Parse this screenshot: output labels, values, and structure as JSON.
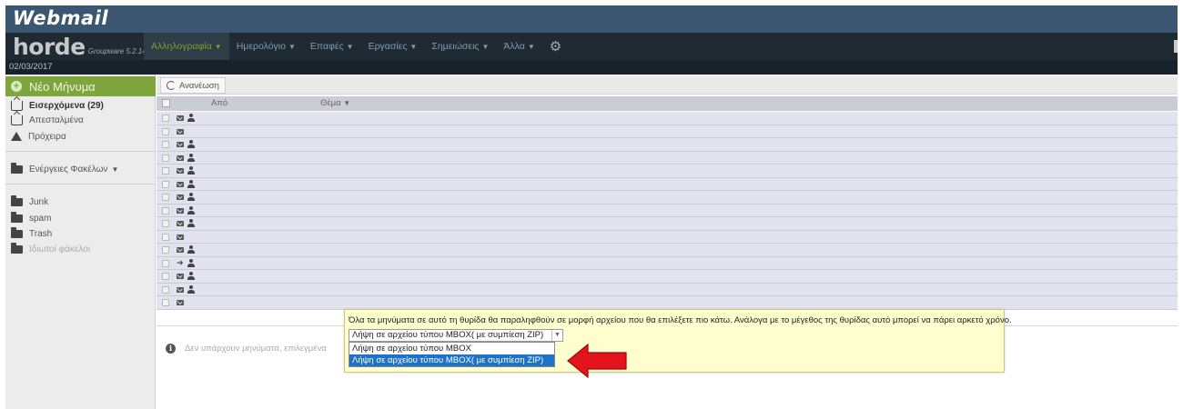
{
  "banner": {
    "brand": "Webmail"
  },
  "navbar": {
    "logo_word": "horde",
    "logo_sub": "Groupware 5.2.14",
    "menu": [
      {
        "label": "Αλληλογραφία",
        "active": true
      },
      {
        "label": "Ημερολόγιο",
        "active": false
      },
      {
        "label": "Επαφές",
        "active": false
      },
      {
        "label": "Εργασίες",
        "active": false
      },
      {
        "label": "Σημειώσεις",
        "active": false
      },
      {
        "label": "Άλλα",
        "active": false
      }
    ],
    "gear_icon": "gear-icon"
  },
  "datebar": {
    "date": "02/03/2017"
  },
  "sidebar": {
    "new_message": "Νέο Μήνυμα",
    "folders": [
      {
        "label": "Εισερχόμενα (29)",
        "icon": "inbox-icon",
        "bold": true
      },
      {
        "label": "Απεσταλμένα",
        "icon": "sent-icon",
        "bold": false
      },
      {
        "label": "Πρόχειρα",
        "icon": "drafts-icon",
        "bold": false
      }
    ],
    "folder_actions": "Ενέργειες Φακέλων",
    "other_folders": [
      {
        "label": "Junk",
        "icon": "folder-icon"
      },
      {
        "label": "spam",
        "icon": "folder-icon"
      },
      {
        "label": "Trash",
        "icon": "folder-icon"
      },
      {
        "label": "Ιδιωτοί φάκελοι",
        "icon": "private-folder-icon"
      }
    ]
  },
  "main": {
    "refresh_label": "Ανανέωση",
    "col_from": "Από",
    "col_subject": "Θέμα",
    "rows": [
      {
        "icons": [
          "envelope",
          "user"
        ]
      },
      {
        "icons": [
          "envelope"
        ]
      },
      {
        "icons": [
          "envelope",
          "user"
        ]
      },
      {
        "icons": [
          "envelope",
          "user"
        ]
      },
      {
        "icons": [
          "envelope",
          "user"
        ]
      },
      {
        "icons": [
          "envelope",
          "user"
        ]
      },
      {
        "icons": [
          "envelope",
          "user"
        ]
      },
      {
        "icons": [
          "envelope",
          "user"
        ]
      },
      {
        "icons": [
          "envelope",
          "user"
        ]
      },
      {
        "icons": [
          "envelope"
        ]
      },
      {
        "icons": [
          "envelope",
          "user"
        ]
      },
      {
        "icons": [
          "forward",
          "user"
        ]
      },
      {
        "icons": [
          "envelope",
          "user"
        ]
      },
      {
        "icons": [
          "envelope",
          "user"
        ]
      },
      {
        "icons": [
          "envelope"
        ]
      }
    ],
    "no_message": "Δεν υπάρχουν μηνύματα, επιλεγμένα"
  },
  "popup": {
    "message": "Όλα τα μηνύματα σε αυτό τη θυρίδα θα παραληφθούν σε μορφή αρχείου που θα επιλέξετε πιο κάτω. Ανάλογα με το μέγεθος της θυρίδας αυτό μπορεί να πάρει αρκετό χρόνο.",
    "selected": "Λήψη σε αρχείου τύπου MBOX( με συμπίεση ZIP)",
    "options": [
      {
        "label": "Λήψη σε αρχείου τύπου MBOX",
        "highlighted": false
      },
      {
        "label": "Λήψη σε αρχείου τύπου MBOX( με συμπίεση ZIP)",
        "highlighted": true
      }
    ]
  }
}
